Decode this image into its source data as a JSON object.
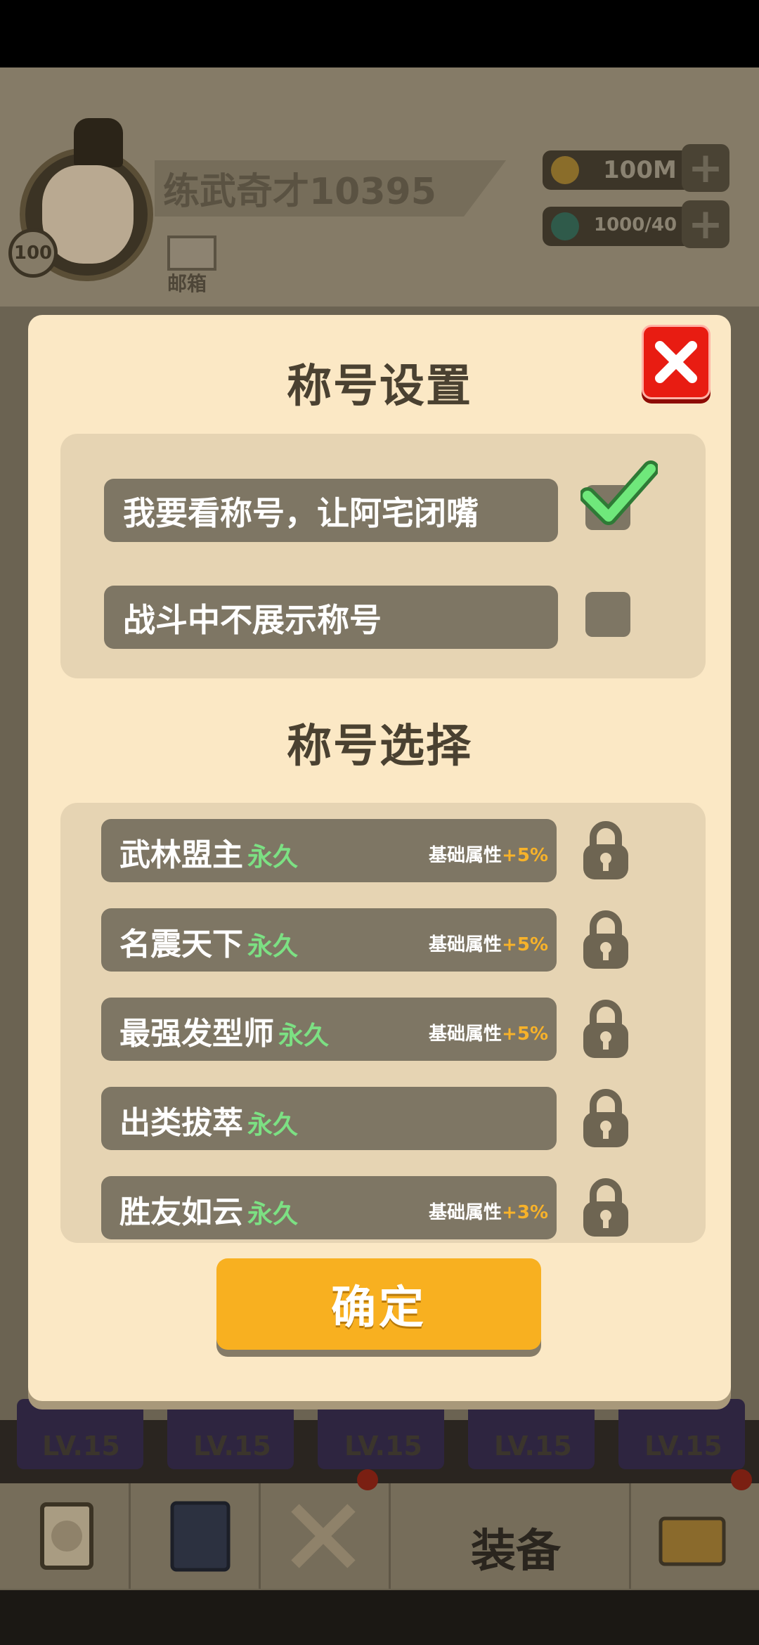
{
  "player": {
    "name": "练武奇才10395",
    "level": "100",
    "mail_label": "邮箱"
  },
  "resources": [
    {
      "icon": "coin-icon",
      "value": "100M"
    },
    {
      "icon": "gem-icon",
      "value": "1000/40"
    }
  ],
  "modal": {
    "title": "称号设置",
    "settings": [
      {
        "label": "我要看称号，让阿宅闭嘴",
        "checked": true
      },
      {
        "label": "战斗中不展示称号",
        "checked": false
      }
    ],
    "select_title": "称号选择",
    "titles": [
      {
        "name": "武林盟主",
        "duration": "永久",
        "attr_label": "基础属性",
        "attr_value": "+5%",
        "locked": true
      },
      {
        "name": "名震天下",
        "duration": "永久",
        "attr_label": "基础属性",
        "attr_value": "+5%",
        "locked": true
      },
      {
        "name": "最强发型师",
        "duration": "永久",
        "attr_label": "基础属性",
        "attr_value": "+5%",
        "locked": true
      },
      {
        "name": "出类拔萃",
        "duration": "永久",
        "attr_label": "",
        "attr_value": "",
        "locked": true
      },
      {
        "name": "胜友如云",
        "duration": "永久",
        "attr_label": "基础属性",
        "attr_value": "+3%",
        "locked": true
      }
    ],
    "confirm_label": "确定"
  },
  "background": {
    "card_levels": [
      "LV.15",
      "LV.15",
      "LV.15",
      "LV.15",
      "LV.15"
    ],
    "nav": {
      "equip_label": "装备"
    }
  },
  "colors": {
    "accent": "#f8b020",
    "modal_bg": "#fbe8c5",
    "close": "#e81c12",
    "perm_green": "#7ce083"
  }
}
